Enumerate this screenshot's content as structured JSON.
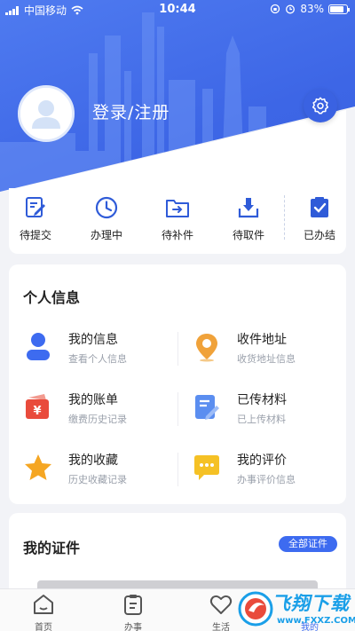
{
  "statusbar": {
    "carrier": "中国移动",
    "time": "10:44",
    "battery": "83%"
  },
  "profile": {
    "login_label": "登录/注册",
    "settings_icon": "gear-icon"
  },
  "order_status": [
    {
      "label": "待提交",
      "icon": "edit-doc-icon"
    },
    {
      "label": "办理中",
      "icon": "clock-icon"
    },
    {
      "label": "待补件",
      "icon": "folder-arrow-icon"
    },
    {
      "label": "待取件",
      "icon": "download-tray-icon"
    },
    {
      "label": "已办结",
      "icon": "check-clipboard-icon"
    }
  ],
  "personal_info": {
    "title": "个人信息",
    "items": [
      {
        "title": "我的信息",
        "subtitle": "查看个人信息",
        "icon": "user-icon",
        "color": "#3d6bf0"
      },
      {
        "title": "收件地址",
        "subtitle": "收货地址信息",
        "icon": "location-pin-icon",
        "color": "#f0a23a"
      },
      {
        "title": "我的账单",
        "subtitle": "缴费历史记录",
        "icon": "wallet-icon",
        "color": "#e94b3c"
      },
      {
        "title": "已传材料",
        "subtitle": "已上传材料",
        "icon": "doc-edit-icon",
        "color": "#5b8ef0"
      },
      {
        "title": "我的收藏",
        "subtitle": "历史收藏记录",
        "icon": "star-icon",
        "color": "#f5a623"
      },
      {
        "title": "我的评价",
        "subtitle": "办事评价信息",
        "icon": "chat-bubble-icon",
        "color": "#f5c125"
      }
    ]
  },
  "certificates": {
    "title": "我的证件",
    "all_label": "全部证件"
  },
  "tabbar": {
    "tabs": [
      {
        "label": "首页",
        "icon": "home-icon"
      },
      {
        "label": "办事",
        "icon": "clipboard-icon"
      },
      {
        "label": "生活",
        "icon": "heart-icon"
      },
      {
        "label": "我的",
        "icon": "profile-icon"
      }
    ]
  },
  "watermark": {
    "text": "飞翔下载",
    "url": "www.FXXZ.COM"
  },
  "colors": {
    "primary": "#3d6bf0",
    "background": "#f2f3f7"
  }
}
